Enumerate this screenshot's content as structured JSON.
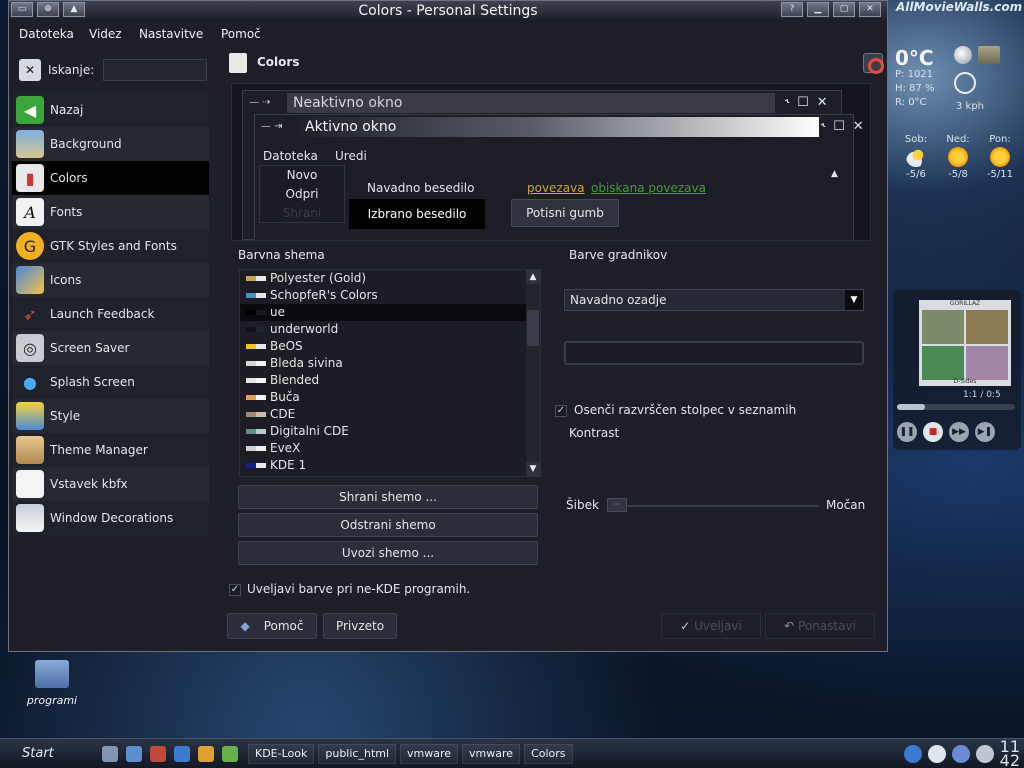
{
  "desktop": {
    "watermark": "AllMovieWalls.com",
    "icon_label": "programi"
  },
  "weather": {
    "temp": "0°C",
    "pressure": "P: 1021",
    "humidity": "H: 87 %",
    "feels": "R: 0°C",
    "wind": "3 kph",
    "forecast": [
      {
        "day": "Sob:",
        "temp": "-5/6"
      },
      {
        "day": "Ned:",
        "temp": "-5/8"
      },
      {
        "day": "Pon:",
        "temp": "-5/11"
      }
    ]
  },
  "music": {
    "cover_title": "GORILLAZ",
    "cover_sub": "D-Sides",
    "track_time": "1:1 / 0:5",
    "progress": 0.24
  },
  "taskbar": {
    "start": "Start",
    "tasks": [
      "KDE-Look",
      "public_html",
      "vmware",
      "vmware",
      "Colors"
    ],
    "clock_hour": "11",
    "clock_min": "42"
  },
  "window": {
    "title": "Colors - Personal Settings",
    "menu": [
      "Datoteka",
      "Videz",
      "Nastavitve",
      "Pomoč"
    ]
  },
  "sidebar": {
    "search_label": "Iskanje:",
    "search_value": "",
    "items": [
      {
        "label": "Nazaj",
        "icon": "back-icon"
      },
      {
        "label": "Background",
        "icon": "background-icon"
      },
      {
        "label": "Colors",
        "icon": "colors-icon",
        "selected": true
      },
      {
        "label": "Fonts",
        "icon": "fonts-icon"
      },
      {
        "label": "GTK Styles and Fonts",
        "icon": "gtk-icon"
      },
      {
        "label": "Icons",
        "icon": "icons-icon"
      },
      {
        "label": "Launch Feedback",
        "icon": "rocket-icon"
      },
      {
        "label": "Screen Saver",
        "icon": "screensaver-icon"
      },
      {
        "label": "Splash Screen",
        "icon": "splash-icon"
      },
      {
        "label": "Style",
        "icon": "style-icon"
      },
      {
        "label": "Theme Manager",
        "icon": "theme-manager-icon"
      },
      {
        "label": "Vstavek kbfx",
        "icon": "kbfx-icon"
      },
      {
        "label": "Window Decorations",
        "icon": "window-decorations-icon"
      }
    ]
  },
  "content": {
    "title": "Colors",
    "preview": {
      "inactive_title": "Neaktivno okno",
      "active_title": "Aktivno okno",
      "menu": [
        "Datoteka",
        "Uredi"
      ],
      "list": [
        "Novo",
        "Odpri",
        "Shrani"
      ],
      "normal_text": "Navadno besedilo",
      "selected_text": "Izbrano besedilo",
      "link": "povezava",
      "visited_link": "obiskana povezava",
      "push_button": "Potisni gumb"
    },
    "scheme_group": "Barvna shema",
    "schemes": [
      {
        "name": "Polyester (Gold)",
        "colors": [
          "#c9a54a",
          "#e8e8ea"
        ]
      },
      {
        "name": "SchopfeR's Colors",
        "colors": [
          "#4a90c0",
          "#e8e8ea"
        ]
      },
      {
        "name": "ue",
        "colors": [
          "#000000",
          "#1a1b22"
        ],
        "selected": true
      },
      {
        "name": "underworld",
        "colors": [
          "#10111a",
          "#202230"
        ]
      },
      {
        "name": "BeOS",
        "colors": [
          "#f2c22a",
          "#e8e8ea"
        ]
      },
      {
        "name": "Bleda sivina",
        "colors": [
          "#d7d7d7",
          "#f1f1f1"
        ]
      },
      {
        "name": "Blended",
        "colors": [
          "#e3e3e3",
          "#f5f5f5"
        ]
      },
      {
        "name": "Buča",
        "colors": [
          "#e3a05a",
          "#f5f5f5"
        ]
      },
      {
        "name": "CDE",
        "colors": [
          "#9b8a7a",
          "#c8bcb0"
        ]
      },
      {
        "name": "Digitalni CDE",
        "colors": [
          "#6a8a8a",
          "#b7cccc"
        ]
      },
      {
        "name": "EveX",
        "colors": [
          "#d0d0d0",
          "#f0f0f0"
        ]
      },
      {
        "name": "KDE 1",
        "colors": [
          "#1a1a8a",
          "#e8e8ea"
        ]
      }
    ],
    "save_scheme": "Shrani shemo ...",
    "remove_scheme": "Odstrani shemo",
    "import_scheme": "Uvozi shemo ...",
    "widget_group": "Barve gradnikov",
    "widget_select": "Navadno ozadje",
    "shade_sorted": "Osenči razvrščen stolpec v seznamih",
    "shade_checked": true,
    "contrast": "Kontrast",
    "weak": "Šibek",
    "strong": "Močan",
    "contrast_value": 0,
    "apply_nonkde": "Uveljavi barve pri ne-KDE programih.",
    "apply_checked": true,
    "help": "Pomoč",
    "defaults": "Privzeto",
    "apply": "Uveljavi",
    "reset": "Ponastavi"
  }
}
